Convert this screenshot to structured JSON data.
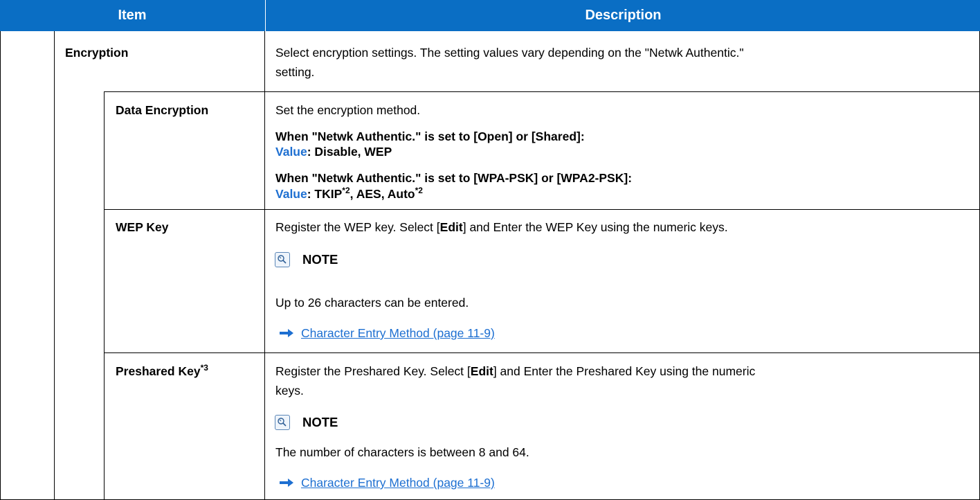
{
  "header": {
    "item": "Item",
    "description": "Description"
  },
  "encryption": {
    "label": "Encryption",
    "desc_line1": "Select encryption settings. The setting values vary depending on the \"Netwk Authentic.\"",
    "desc_line2": "setting."
  },
  "data_encryption": {
    "label": "Data Encryption",
    "desc": "Set the encryption method.",
    "cond1": "When \"Netwk Authentic.\" is set to [Open] or [Shared]:",
    "value_word": "Value",
    "value1": ": Disable, WEP",
    "cond2": "When \"Netwk Authentic.\" is set to [WPA-PSK] or [WPA2-PSK]:",
    "value2_a": ": TKIP",
    "sup_a": "*2",
    "value2_b": ", AES, Auto",
    "sup_b": "*2"
  },
  "wep_key": {
    "label": "WEP Key",
    "desc_pre": "Register the WEP key. Select [",
    "desc_edit": "Edit",
    "desc_post": "] and Enter the WEP Key using the numeric keys.",
    "note_title": "NOTE",
    "note_text": "Up to 26 characters can be entered.",
    "link": "Character Entry Method (page 11-9)"
  },
  "preshared_key": {
    "label": "Preshared Key",
    "label_sup": "*3",
    "desc_pre": "Register the Preshared Key. Select [",
    "desc_edit": "Edit",
    "desc_post": "] and Enter the Preshared Key using the numeric",
    "desc_line2": "keys.",
    "note_title": "NOTE",
    "note_text": "The number of characters is between 8 and 64.",
    "link": "Character Entry Method (page 11-9)"
  },
  "icons": {
    "note": "lightbulb-note-icon",
    "arrow": "arrow-right-icon"
  },
  "colors": {
    "header_bg": "#0a6ec4",
    "accent": "#1d6fd1"
  }
}
